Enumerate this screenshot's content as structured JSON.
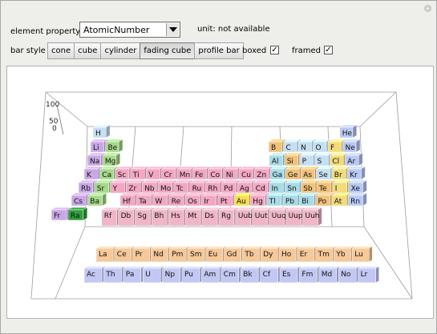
{
  "controls": {
    "element_property_label": "element property",
    "selected_property": "AtomicNumber",
    "unit_label": "unit: not available",
    "bar_style_label": "bar style",
    "bar_styles": [
      "cone",
      "cube",
      "cylinder",
      "fading cube",
      "profile bar"
    ],
    "active_bar_style": "fading cube",
    "boxed_label": "boxed",
    "boxed_checked": true,
    "framed_label": "framed",
    "framed_checked": true,
    "check_glyph": "✓"
  },
  "plot": {
    "axis_ticks": [
      "0",
      "50",
      "100"
    ],
    "main_rows": [
      [
        "H",
        "",
        "",
        "",
        "",
        "",
        "",
        "",
        "",
        "",
        "",
        "",
        "",
        "",
        "",
        "",
        "",
        "He"
      ],
      [
        "Li",
        "Be",
        "",
        "",
        "",
        "",
        "",
        "",
        "",
        "",
        "",
        "",
        "B",
        "C",
        "N",
        "O",
        "F",
        "Ne"
      ],
      [
        "Na",
        "Mg",
        "",
        "",
        "",
        "",
        "",
        "",
        "",
        "",
        "",
        "",
        "Al",
        "Si",
        "P",
        "S",
        "Cl",
        "Ar"
      ],
      [
        "K",
        "Ca",
        "Sc",
        "Ti",
        "V",
        "Cr",
        "Mn",
        "Fe",
        "Co",
        "Ni",
        "Cu",
        "Zn",
        "Ga",
        "Ge",
        "As",
        "Se",
        "Br",
        "Kr"
      ],
      [
        "Rb",
        "Sr",
        "Y",
        "Zr",
        "Nb",
        "Mo",
        "Tc",
        "Ru",
        "Rh",
        "Pd",
        "Ag",
        "Cd",
        "In",
        "Sn",
        "Sb",
        "Te",
        "I",
        "Xe"
      ],
      [
        "Cs",
        "Ba",
        "",
        "Hf",
        "Ta",
        "W",
        "Re",
        "Os",
        "Ir",
        "Pt",
        "Au",
        "Hg",
        "Tl",
        "Pb",
        "Bi",
        "Po",
        "At",
        "Rn"
      ],
      [
        "Fr",
        "Ra",
        "",
        "Rf",
        "Db",
        "Sg",
        "Bh",
        "Hs",
        "Mt",
        "Ds",
        "Rg",
        "Uub",
        "Uut",
        "Uuq",
        "Uup",
        "Uuh",
        "",
        ""
      ]
    ],
    "lanthanides": [
      "La",
      "Ce",
      "Pr",
      "Nd",
      "Pm",
      "Sm",
      "Eu",
      "Gd",
      "Tb",
      "Dy",
      "Ho",
      "Er",
      "Tm",
      "Yb",
      "Lu"
    ],
    "actinides": [
      "Ac",
      "Th",
      "Pa",
      "U",
      "Np",
      "Pu",
      "Am",
      "Cm",
      "Bk",
      "Cf",
      "Es",
      "Fm",
      "Md",
      "No",
      "Lr"
    ],
    "colors": {
      "alkali": "#c9a7e6",
      "alkaline": "#a6d88a",
      "transition": "#f2a7c3",
      "post": "#a9dbe6",
      "metalloid": "#f1c27a",
      "nonmetal": "#c4e0f2",
      "halogen": "#f2dc7a",
      "noble": "#b9c8f5",
      "lanth": "#f6c89a",
      "actin": "#c3c7f3",
      "unknown": "#f0b6c8",
      "gold": "#f7dd54",
      "radium": "#2f9e3c"
    }
  }
}
